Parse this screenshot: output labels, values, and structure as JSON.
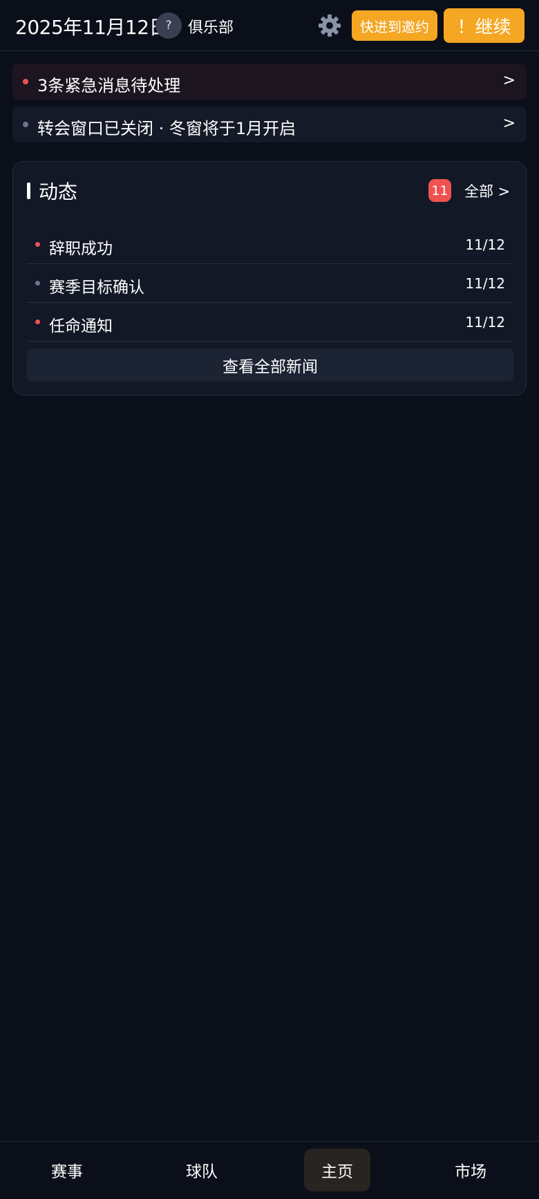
{
  "header": {
    "date": "2025年11月12日",
    "club_badge": "?",
    "club_name": "俱乐部",
    "settings_icon": "gear-icon",
    "fast_forward_label": "快进到邀约",
    "continue_label": "！继续",
    "accent_color": "#f5a623"
  },
  "notices": [
    {
      "text": "3条紧急消息待处理",
      "chevron": ">",
      "dot_color": "#f05252"
    },
    {
      "text": "转会窗口已关闭 · 冬窗将于1月开启",
      "chevron": ">",
      "dot_color": "#6b7590"
    }
  ],
  "feed": {
    "title": "动态",
    "count": "11",
    "all_link": "全部 >",
    "items": [
      {
        "title": "辞职成功",
        "date": "11/12",
        "dot_color": "#f05252"
      },
      {
        "title": "赛季目标确认",
        "date": "11/12",
        "dot_color": "#6b7590"
      },
      {
        "title": "任命通知",
        "date": "11/12",
        "dot_color": "#f05252"
      }
    ],
    "view_all_label": "查看全部新闻"
  },
  "bottom_nav": {
    "items": [
      {
        "label": "赛事",
        "active": false
      },
      {
        "label": "球队",
        "active": false
      },
      {
        "label": "主页",
        "active": true
      },
      {
        "label": "市场",
        "active": false
      }
    ]
  }
}
